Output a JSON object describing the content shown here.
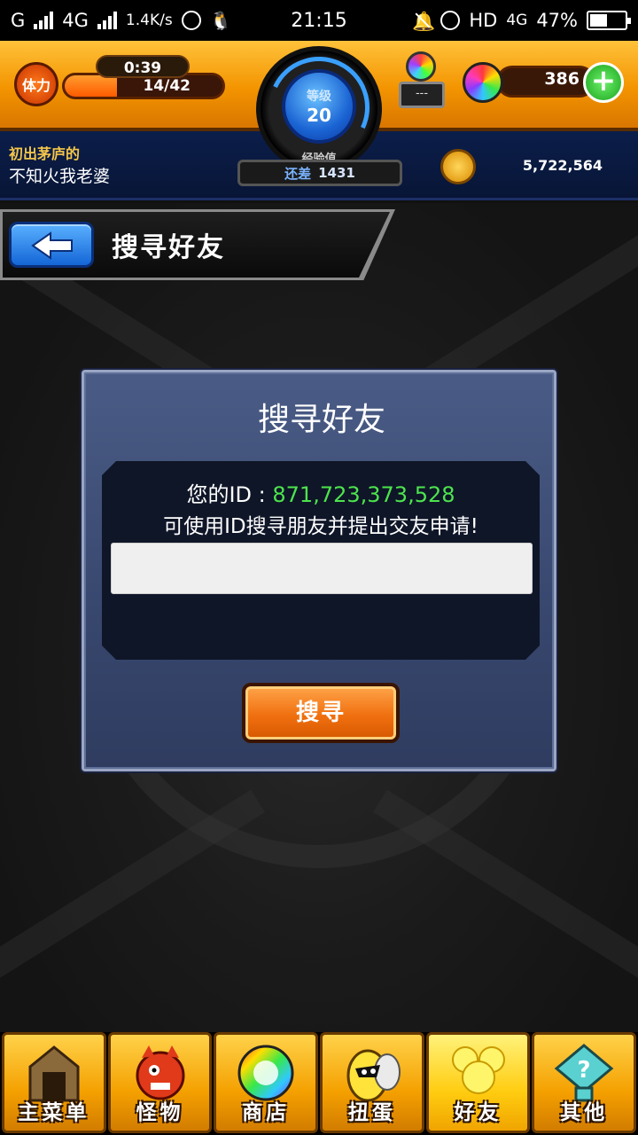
{
  "status_bar": {
    "carrier": "G",
    "network": "4G",
    "speed": "1.4K/s",
    "time": "21:15",
    "hd": "HD",
    "network_right": "4G",
    "battery": "47%"
  },
  "hud": {
    "stamina_label": "体力",
    "stamina_timer": "0:39",
    "stamina_value": "14/42",
    "stamina_fraction": 0.333,
    "level_label": "等级",
    "level_value": "20",
    "exp_label": "经验值",
    "exp_remaining_label": "还差",
    "exp_remaining_value": "1431",
    "badge_placeholder": "---",
    "gems": "386",
    "coins": "5,722,564",
    "player_title": "初出茅庐的",
    "player_name": "不知火我老婆"
  },
  "header": {
    "title": "搜寻好友"
  },
  "dialog": {
    "title": "搜寻好友",
    "id_label": "您的ID : ",
    "id_value": "871,723,373,528",
    "hint": "可使用ID搜寻朋友并提出交友申请!",
    "input_value": "",
    "search_button": "搜寻"
  },
  "nav": [
    {
      "label": "主菜单",
      "icon": "home-gate-icon"
    },
    {
      "label": "怪物",
      "icon": "monster-icon"
    },
    {
      "label": "商店",
      "icon": "orb-shop-icon"
    },
    {
      "label": "扭蛋",
      "icon": "gacha-egg-icon"
    },
    {
      "label": "好友",
      "icon": "friends-icon"
    },
    {
      "label": "其他",
      "icon": "other-icon"
    }
  ],
  "colors": {
    "hud_orange": "#f39400",
    "id_green": "#4de44d",
    "dialog_blue": "#3e4e76",
    "button_orange": "#f07010"
  }
}
